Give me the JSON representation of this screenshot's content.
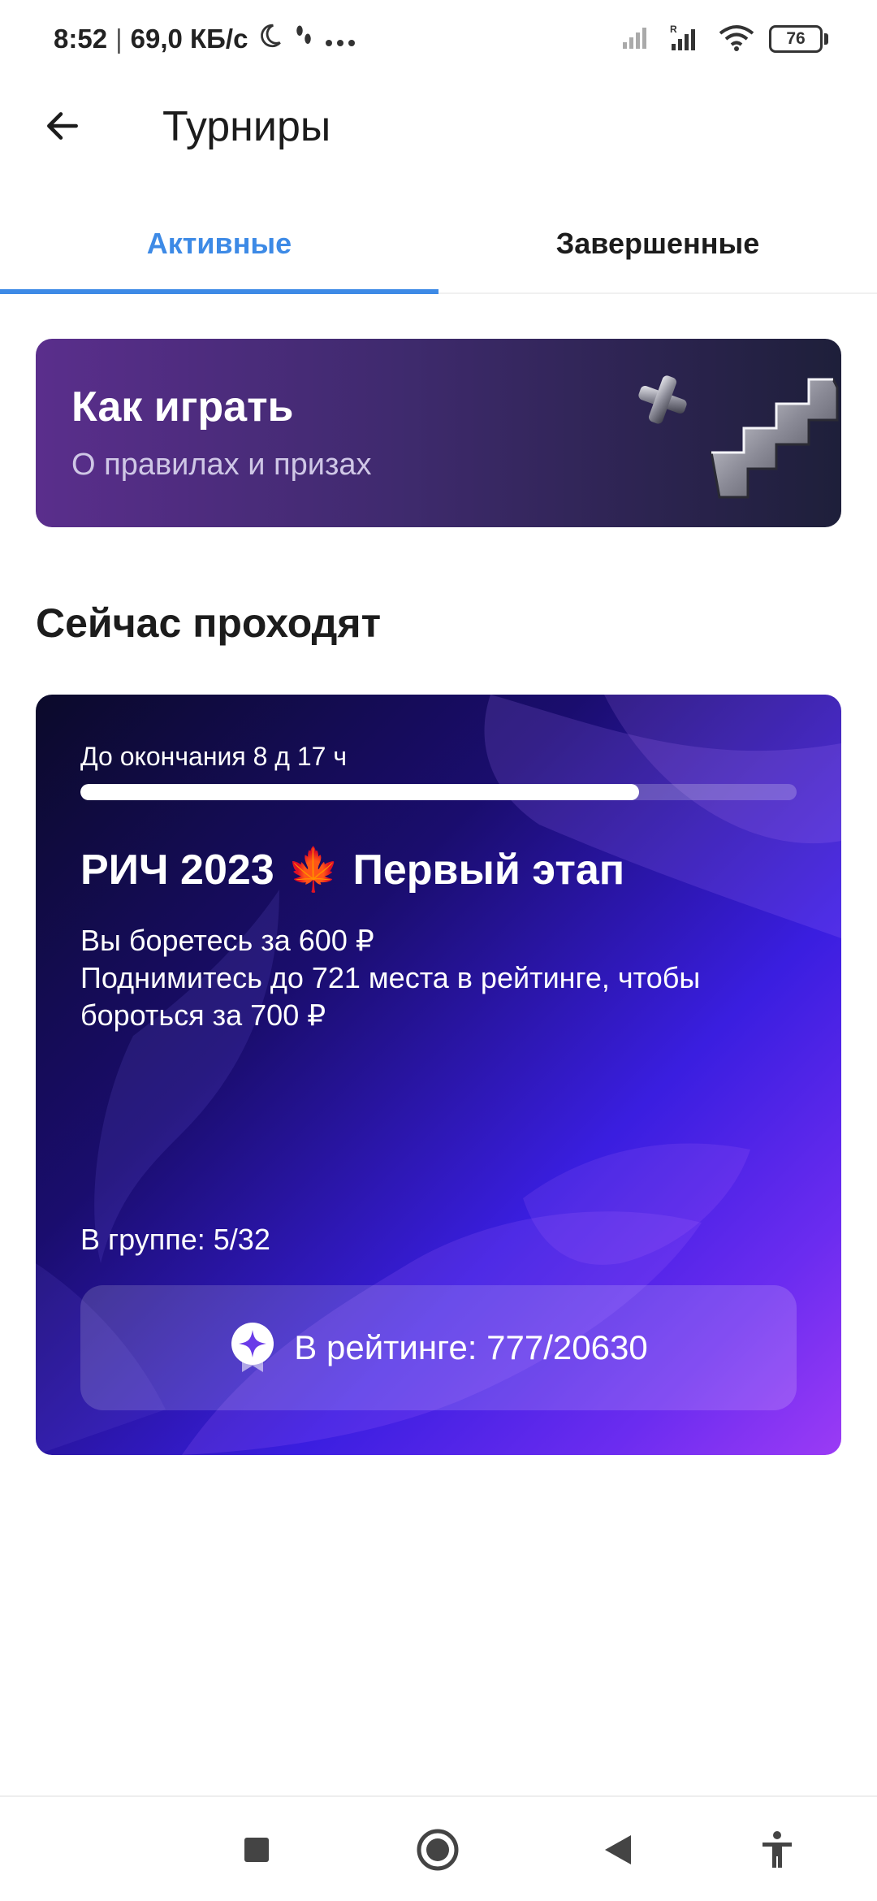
{
  "status_bar": {
    "time": "8:52",
    "separator": "|",
    "speed": "69,0 КБ/с",
    "battery_level": "76",
    "icons": [
      "moon-icon",
      "steps-icon",
      "more-dots-icon",
      "signal-icon",
      "signal-roaming-icon",
      "wifi-icon",
      "battery-icon"
    ]
  },
  "app_bar": {
    "title": "Турниры",
    "back_icon": "arrow-left-icon"
  },
  "tabs": [
    {
      "label": "Активные",
      "active": true
    },
    {
      "label": "Завершенные",
      "active": false
    }
  ],
  "howto": {
    "title": "Как играть",
    "subtitle": "О правилах и призах"
  },
  "section": {
    "title": "Сейчас проходят"
  },
  "tournament": {
    "countdown": "До окончания 8 д 17 ч",
    "progress_fraction": 0.78,
    "name_part1": "РИЧ 2023",
    "name_emoji": "🍁",
    "name_part2": "Первый этап",
    "desc_line1": "Вы боретесь за 600 ₽",
    "desc_line2": "Поднимитесь до 721 места в рейтинге, чтобы бороться за 700 ₽",
    "group": "В группе: 5/32",
    "rating_label": "В рейтинге: 777/20630",
    "colors": {
      "accent": "#3d8ae6",
      "card_start": "#0b0a2a",
      "card_end": "#9b3bf5"
    }
  },
  "nav_bar": {
    "icons": [
      "recents-square-icon",
      "home-circle-icon",
      "back-triangle-icon",
      "accessibility-icon"
    ]
  }
}
